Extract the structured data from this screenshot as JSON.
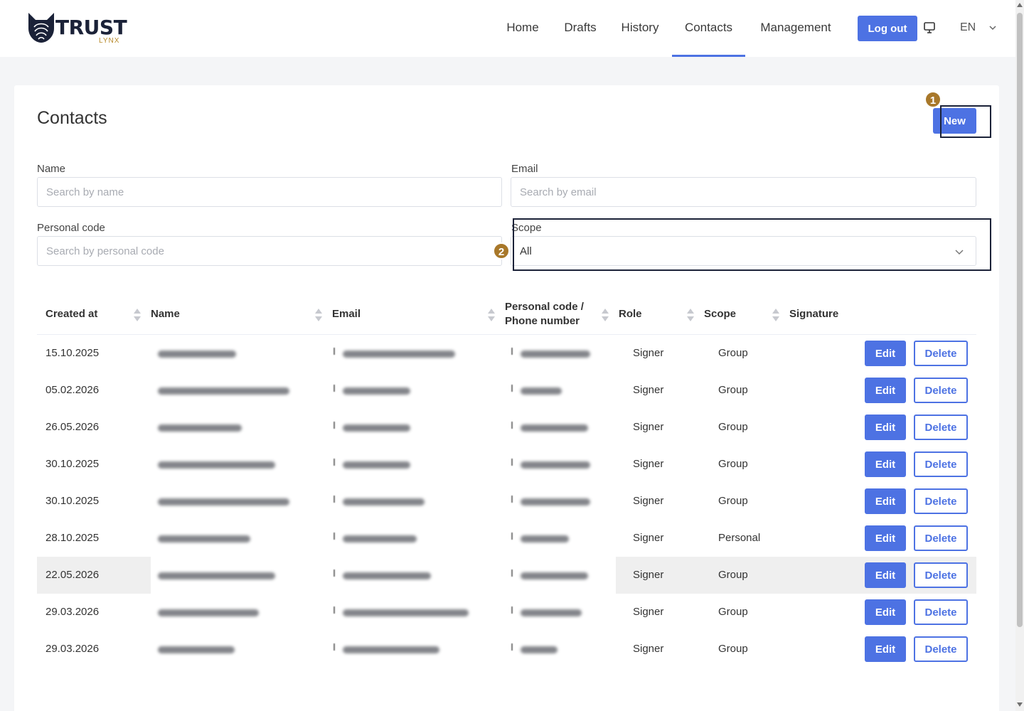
{
  "header": {
    "logo_text": "TRUST",
    "logo_sub": "LYNX",
    "nav": [
      "Home",
      "Drafts",
      "History",
      "Contacts",
      "Management"
    ],
    "active_nav": "Contacts",
    "logout_label": "Log out",
    "language": "EN"
  },
  "page": {
    "title": "Contacts",
    "new_label": "New"
  },
  "filters": {
    "name_label": "Name",
    "name_placeholder": "Search by name",
    "email_label": "Email",
    "email_placeholder": "Search by email",
    "personal_code_label": "Personal code",
    "personal_code_placeholder": "Search by personal code",
    "scope_label": "Scope",
    "scope_value": "All"
  },
  "annotations": [
    "1",
    "2"
  ],
  "table": {
    "columns": [
      "Created at",
      "Name",
      "Email",
      "Personal code / Phone number",
      "Role",
      "Scope",
      "Signature"
    ],
    "edit_label": "Edit",
    "delete_label": "Delete",
    "rows": [
      {
        "created_at": "15.10.2025",
        "role": "Signer",
        "scope": "Group"
      },
      {
        "created_at": "05.02.2026",
        "role": "Signer",
        "scope": "Group"
      },
      {
        "created_at": "26.05.2026",
        "role": "Signer",
        "scope": "Group"
      },
      {
        "created_at": "30.10.2025",
        "role": "Signer",
        "scope": "Group"
      },
      {
        "created_at": "30.10.2025",
        "role": "Signer",
        "scope": "Group"
      },
      {
        "created_at": "28.10.2025",
        "role": "Signer",
        "scope": "Personal"
      },
      {
        "created_at": "22.05.2026",
        "role": "Signer",
        "scope": "Group"
      },
      {
        "created_at": "29.03.2026",
        "role": "Signer",
        "scope": "Group"
      },
      {
        "created_at": "29.03.2026",
        "role": "Signer",
        "scope": "Group"
      }
    ]
  },
  "colors": {
    "accent": "#4d72e3",
    "badge": "#a8782a",
    "highlight": "#1b2238"
  }
}
